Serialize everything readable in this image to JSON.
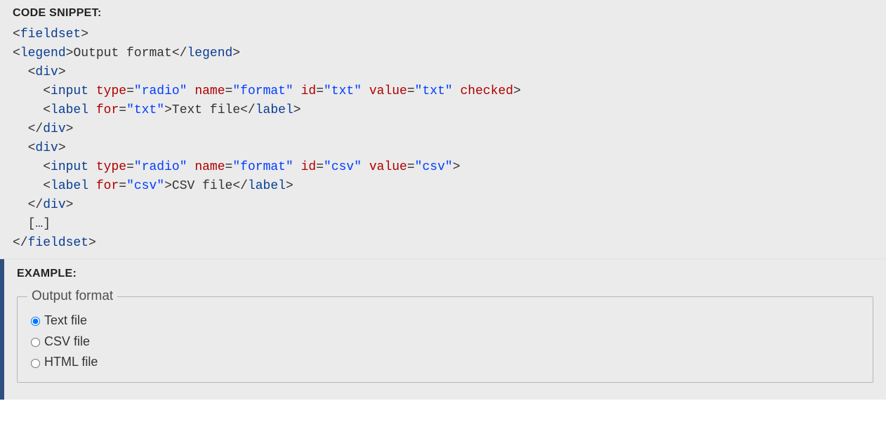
{
  "snippet": {
    "header": "CODE SNIPPET:",
    "lines": [
      [
        {
          "t": "<",
          "c": "p"
        },
        {
          "t": "fieldset",
          "c": "tg"
        },
        {
          "t": ">",
          "c": "p"
        }
      ],
      [
        {
          "t": "<",
          "c": "p"
        },
        {
          "t": "legend",
          "c": "tg"
        },
        {
          "t": ">",
          "c": "p"
        },
        {
          "t": "Output format",
          "c": "tx"
        },
        {
          "t": "</",
          "c": "p"
        },
        {
          "t": "legend",
          "c": "tg"
        },
        {
          "t": ">",
          "c": "p"
        }
      ],
      [
        {
          "t": "  ",
          "c": "p"
        },
        {
          "t": "<",
          "c": "p"
        },
        {
          "t": "div",
          "c": "tg"
        },
        {
          "t": ">",
          "c": "p"
        }
      ],
      [
        {
          "t": "    ",
          "c": "p"
        },
        {
          "t": "<",
          "c": "p"
        },
        {
          "t": "input",
          "c": "tg"
        },
        {
          "t": " ",
          "c": "p"
        },
        {
          "t": "type",
          "c": "at"
        },
        {
          "t": "=",
          "c": "p"
        },
        {
          "t": "\"radio\"",
          "c": "av"
        },
        {
          "t": " ",
          "c": "p"
        },
        {
          "t": "name",
          "c": "at"
        },
        {
          "t": "=",
          "c": "p"
        },
        {
          "t": "\"format\"",
          "c": "av"
        },
        {
          "t": " ",
          "c": "p"
        },
        {
          "t": "id",
          "c": "at"
        },
        {
          "t": "=",
          "c": "p"
        },
        {
          "t": "\"txt\"",
          "c": "av"
        },
        {
          "t": " ",
          "c": "p"
        },
        {
          "t": "value",
          "c": "at"
        },
        {
          "t": "=",
          "c": "p"
        },
        {
          "t": "\"txt\"",
          "c": "av"
        },
        {
          "t": " ",
          "c": "p"
        },
        {
          "t": "checked",
          "c": "ck"
        },
        {
          "t": ">",
          "c": "p"
        }
      ],
      [
        {
          "t": "    ",
          "c": "p"
        },
        {
          "t": "<",
          "c": "p"
        },
        {
          "t": "label",
          "c": "tg"
        },
        {
          "t": " ",
          "c": "p"
        },
        {
          "t": "for",
          "c": "at"
        },
        {
          "t": "=",
          "c": "p"
        },
        {
          "t": "\"txt\"",
          "c": "av"
        },
        {
          "t": ">",
          "c": "p"
        },
        {
          "t": "Text file",
          "c": "tx"
        },
        {
          "t": "</",
          "c": "p"
        },
        {
          "t": "label",
          "c": "tg"
        },
        {
          "t": ">",
          "c": "p"
        }
      ],
      [
        {
          "t": "  ",
          "c": "p"
        },
        {
          "t": "</",
          "c": "p"
        },
        {
          "t": "div",
          "c": "tg"
        },
        {
          "t": ">",
          "c": "p"
        }
      ],
      [
        {
          "t": "  ",
          "c": "p"
        },
        {
          "t": "<",
          "c": "p"
        },
        {
          "t": "div",
          "c": "tg"
        },
        {
          "t": ">",
          "c": "p"
        }
      ],
      [
        {
          "t": "    ",
          "c": "p"
        },
        {
          "t": "<",
          "c": "p"
        },
        {
          "t": "input",
          "c": "tg"
        },
        {
          "t": " ",
          "c": "p"
        },
        {
          "t": "type",
          "c": "at"
        },
        {
          "t": "=",
          "c": "p"
        },
        {
          "t": "\"radio\"",
          "c": "av"
        },
        {
          "t": " ",
          "c": "p"
        },
        {
          "t": "name",
          "c": "at"
        },
        {
          "t": "=",
          "c": "p"
        },
        {
          "t": "\"format\"",
          "c": "av"
        },
        {
          "t": " ",
          "c": "p"
        },
        {
          "t": "id",
          "c": "at"
        },
        {
          "t": "=",
          "c": "p"
        },
        {
          "t": "\"csv\"",
          "c": "av"
        },
        {
          "t": " ",
          "c": "p"
        },
        {
          "t": "value",
          "c": "at"
        },
        {
          "t": "=",
          "c": "p"
        },
        {
          "t": "\"csv\"",
          "c": "av"
        },
        {
          "t": ">",
          "c": "p"
        }
      ],
      [
        {
          "t": "    ",
          "c": "p"
        },
        {
          "t": "<",
          "c": "p"
        },
        {
          "t": "label",
          "c": "tg"
        },
        {
          "t": " ",
          "c": "p"
        },
        {
          "t": "for",
          "c": "at"
        },
        {
          "t": "=",
          "c": "p"
        },
        {
          "t": "\"csv\"",
          "c": "av"
        },
        {
          "t": ">",
          "c": "p"
        },
        {
          "t": "CSV file",
          "c": "tx"
        },
        {
          "t": "</",
          "c": "p"
        },
        {
          "t": "label",
          "c": "tg"
        },
        {
          "t": ">",
          "c": "p"
        }
      ],
      [
        {
          "t": "  ",
          "c": "p"
        },
        {
          "t": "</",
          "c": "p"
        },
        {
          "t": "div",
          "c": "tg"
        },
        {
          "t": ">",
          "c": "p"
        }
      ],
      [
        {
          "t": "  […]",
          "c": "tx"
        }
      ],
      [
        {
          "t": "</",
          "c": "p"
        },
        {
          "t": "fieldset",
          "c": "tg"
        },
        {
          "t": ">",
          "c": "p"
        }
      ]
    ]
  },
  "example": {
    "header": "EXAMPLE:",
    "legend": "Output format",
    "options": [
      {
        "label": "Text file",
        "id": "txt",
        "checked": true
      },
      {
        "label": "CSV file",
        "id": "csv",
        "checked": false
      },
      {
        "label": "HTML file",
        "id": "html",
        "checked": false
      }
    ]
  }
}
